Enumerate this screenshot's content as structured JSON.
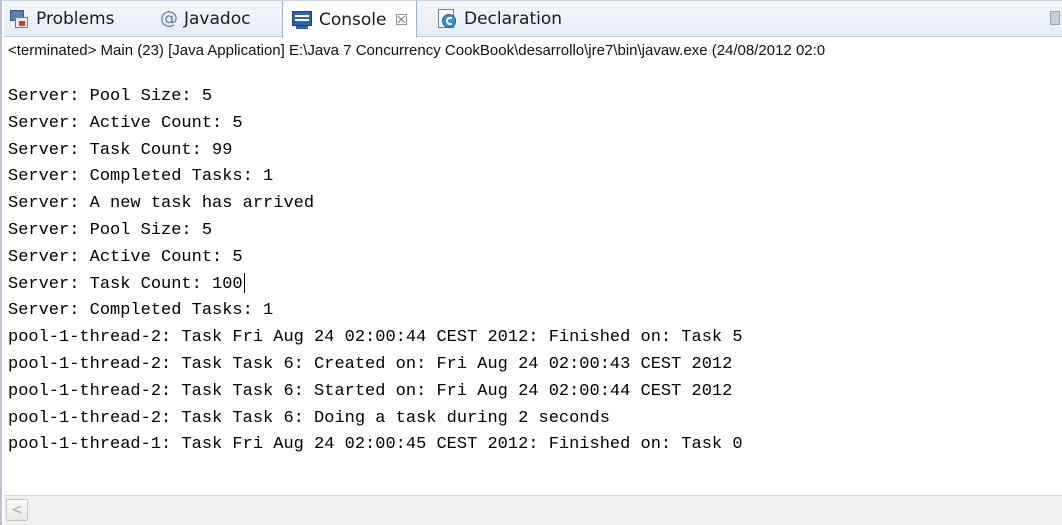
{
  "tabs": [
    {
      "label": "Problems",
      "icon": "problems-icon"
    },
    {
      "label": "Javadoc",
      "icon": "at-icon"
    },
    {
      "label": "Console",
      "icon": "console-icon",
      "active": true,
      "close": "☒"
    },
    {
      "label": "Declaration",
      "icon": "declaration-icon"
    }
  ],
  "status": "<terminated> Main (23) [Java Application] E:\\Java 7 Concurrency CookBook\\desarrollo\\jre7\\bin\\javaw.exe (24/08/2012 02:0",
  "console": {
    "lines": [
      "Server: Pool Size: 5",
      "Server: Active Count: 5",
      "Server: Task Count: 99",
      "Server: Completed Tasks: 1",
      "Server: A new task has arrived",
      "Server: Pool Size: 5",
      "Server: Active Count: 5",
      "Server: Task Count: 100",
      "Server: Completed Tasks: 1",
      "pool-1-thread-2: Task Fri Aug 24 02:00:44 CEST 2012: Finished on: Task 5",
      "pool-1-thread-2: Task Task 6: Created on: Fri Aug 24 02:00:43 CEST 2012",
      "pool-1-thread-2: Task Task 6: Started on: Fri Aug 24 02:00:44 CEST 2012",
      "pool-1-thread-2: Task Task 6: Doing a task during 2 seconds",
      "pool-1-thread-1: Task Fri Aug 24 02:00:45 CEST 2012: Finished on: Task 0"
    ]
  },
  "scrollbar": {
    "left_arrow": "<"
  }
}
